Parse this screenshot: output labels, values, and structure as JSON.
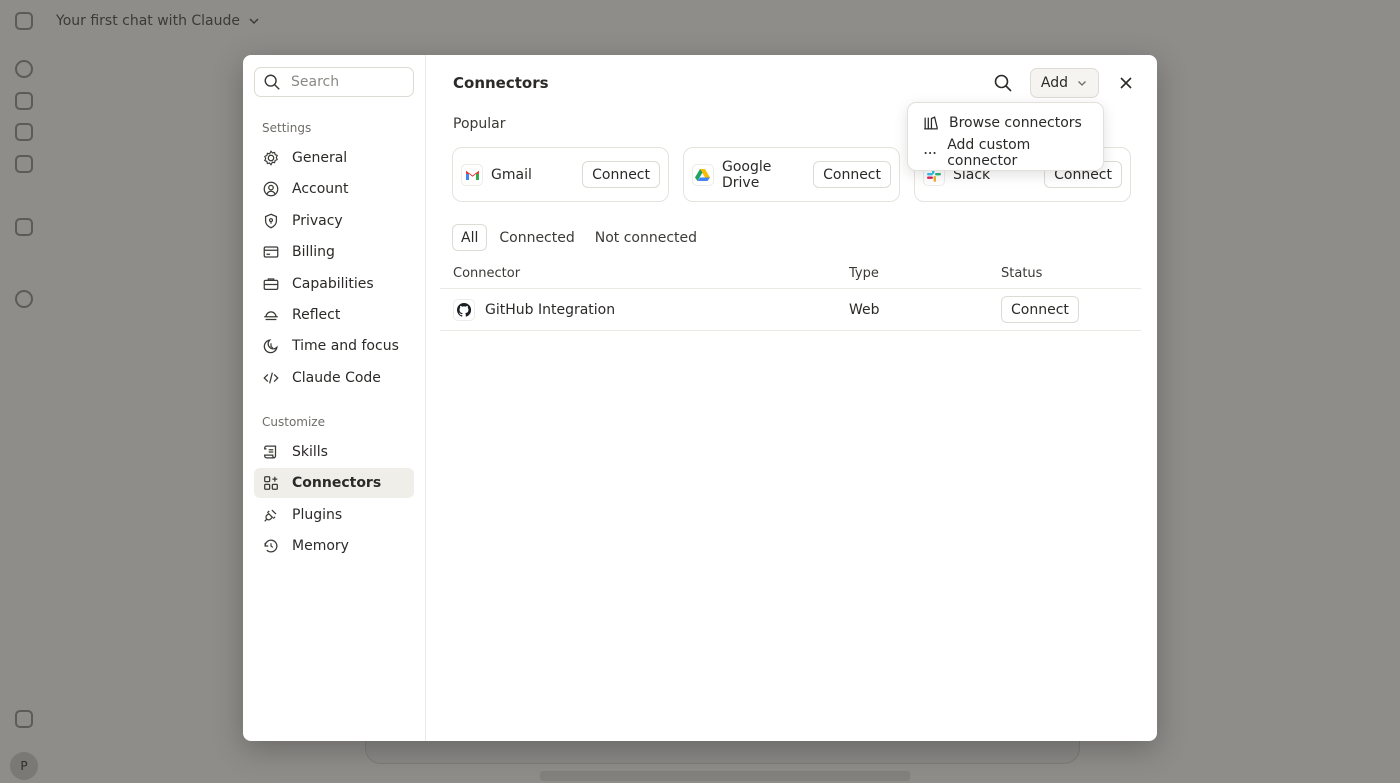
{
  "background": {
    "chat_title": "Your first chat with Claude",
    "avatar_initial": "P"
  },
  "modal": {
    "sidebar": {
      "search_placeholder": "Search",
      "settings_label": "Settings",
      "settings_items": [
        {
          "label": "General",
          "icon": "gear-icon"
        },
        {
          "label": "Account",
          "icon": "user-circle-icon"
        },
        {
          "label": "Privacy",
          "icon": "shield-icon"
        },
        {
          "label": "Billing",
          "icon": "credit-card-icon"
        },
        {
          "label": "Capabilities",
          "icon": "briefcase-icon"
        },
        {
          "label": "Reflect",
          "icon": "sunrise-icon"
        },
        {
          "label": "Time and focus",
          "icon": "moon-clock-icon"
        },
        {
          "label": "Claude Code",
          "icon": "code-icon"
        }
      ],
      "customize_label": "Customize",
      "customize_items": [
        {
          "label": "Skills",
          "icon": "scroll-icon"
        },
        {
          "label": "Connectors",
          "icon": "grid-plus-icon",
          "active": true
        },
        {
          "label": "Plugins",
          "icon": "plug-icon"
        },
        {
          "label": "Memory",
          "icon": "history-icon"
        }
      ]
    },
    "header": {
      "title": "Connectors",
      "add_label": "Add"
    },
    "popular_label": "Popular",
    "popular_cards": [
      {
        "name": "Gmail",
        "button": "Connect",
        "icon": "gmail-icon"
      },
      {
        "name": "Google Drive",
        "button": "Connect",
        "icon": "google-drive-icon"
      },
      {
        "name": "Slack",
        "button": "Connect",
        "icon": "slack-icon"
      }
    ],
    "filters": [
      "All",
      "Connected",
      "Not connected"
    ],
    "active_filter": "All",
    "table": {
      "columns": [
        "Connector",
        "Type",
        "Status"
      ],
      "rows": [
        {
          "name": "GitHub Integration",
          "type": "Web",
          "status_button": "Connect",
          "icon": "github-icon"
        }
      ]
    },
    "dropdown": {
      "items": [
        {
          "label": "Browse connectors",
          "icon": "library-icon"
        },
        {
          "label": "Add custom connector",
          "icon": "more-horizontal-icon"
        }
      ]
    }
  }
}
